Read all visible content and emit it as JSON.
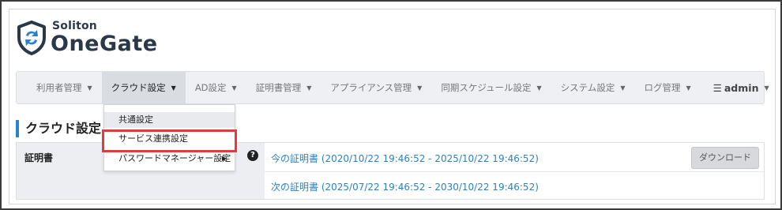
{
  "logo": {
    "brand": "Soliton",
    "product": "OneGate"
  },
  "nav": {
    "items": [
      {
        "label": "利用者管理"
      },
      {
        "label": "クラウド設定"
      },
      {
        "label": "AD設定"
      },
      {
        "label": "証明書管理"
      },
      {
        "label": "アプライアンス管理"
      },
      {
        "label": "同期スケジュール設定"
      },
      {
        "label": "システム設定"
      },
      {
        "label": "ログ管理"
      }
    ],
    "admin_label": "admin",
    "active_index": 1
  },
  "dropdown": {
    "items": [
      {
        "label": "共通設定"
      },
      {
        "label": "サービス連携設定"
      },
      {
        "label": "パスワードマネージャー設定"
      }
    ],
    "highlighted_index": 1
  },
  "page": {
    "heading": "クラウド設定"
  },
  "certificate": {
    "label": "証明書",
    "current": "今の証明書 (2020/10/22 19:46:52 - 2025/10/22 19:46:52)",
    "next": "次の証明書 (2025/07/22 19:46:52 - 2030/10/22 19:46:52)",
    "download_label": "ダウンロード"
  },
  "colors": {
    "accent": "#2a82c8",
    "highlight": "#e8383d",
    "logo": "#2b3848"
  }
}
